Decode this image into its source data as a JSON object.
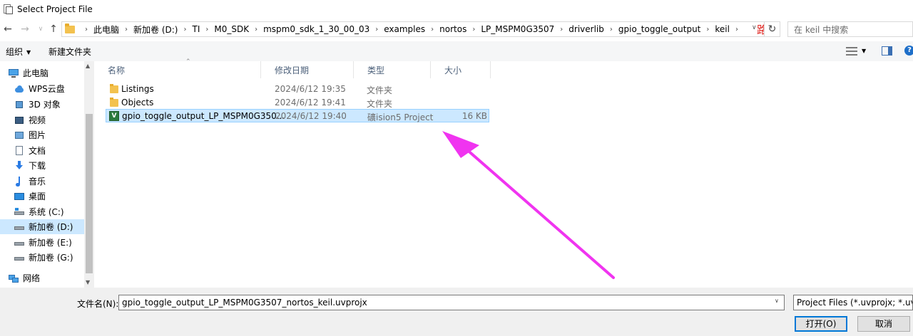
{
  "window": {
    "title": "Select Project File"
  },
  "nav": {
    "back": "←",
    "forward": "→",
    "dropdown": "∨",
    "up": "↑"
  },
  "breadcrumb": [
    "此电脑",
    "新加卷 (D:)",
    "TI",
    "M0_SDK",
    "mspm0_sdk_1_30_00_03",
    "examples",
    "nortos",
    "LP_MSPM0G3507",
    "driverlib",
    "gpio_toggle_output",
    "keil"
  ],
  "breadcrumb_separator": "›",
  "annotation": {
    "path_note": "路径",
    "color": "#e0211c",
    "arrow_color": "#f034f0"
  },
  "search": {
    "placeholder": "在 keil 中搜索"
  },
  "toolbar": {
    "organize": "组织",
    "new_folder": "新建文件夹",
    "help": "?"
  },
  "nav_pane": [
    {
      "label": "此电脑",
      "icon": "computer-icon"
    },
    {
      "label": "WPS云盘",
      "icon": "cloud-icon"
    },
    {
      "label": "3D 对象",
      "icon": "cube-icon"
    },
    {
      "label": "视频",
      "icon": "video-icon"
    },
    {
      "label": "图片",
      "icon": "picture-icon"
    },
    {
      "label": "文档",
      "icon": "document-icon"
    },
    {
      "label": "下载",
      "icon": "download-icon"
    },
    {
      "label": "音乐",
      "icon": "music-icon"
    },
    {
      "label": "桌面",
      "icon": "desktop-icon"
    },
    {
      "label": "系统 (C:)",
      "icon": "drive-c-icon"
    },
    {
      "label": "新加卷 (D:)",
      "icon": "drive-icon",
      "selected": true
    },
    {
      "label": "新加卷 (E:)",
      "icon": "drive-icon"
    },
    {
      "label": "新加卷 (G:)",
      "icon": "drive-icon"
    },
    {
      "label": "网络",
      "icon": "network-icon"
    }
  ],
  "columns": {
    "name": "名称",
    "date": "修改日期",
    "type": "类型",
    "size": "大小"
  },
  "files": [
    {
      "name": "Listings",
      "date": "2024/6/12 19:35",
      "type": "文件夹",
      "size": "",
      "kind": "folder"
    },
    {
      "name": "Objects",
      "date": "2024/6/12 19:41",
      "type": "文件夹",
      "size": "",
      "kind": "folder"
    },
    {
      "name": "gpio_toggle_output_LP_MSPM0G350...",
      "date": "2024/6/12 19:40",
      "type": "礦ision5 Project",
      "size": "16 KB",
      "kind": "uvproj",
      "selected": true
    }
  ],
  "footer": {
    "filename_label": "文件名(N):",
    "filename_value": "gpio_toggle_output_LP_MSPM0G3507_nortos_keil.uvprojx",
    "filetype_value": "Project Files (*.uvprojx;  *.uvproj)",
    "open": "打开(O)",
    "cancel": "取消"
  }
}
